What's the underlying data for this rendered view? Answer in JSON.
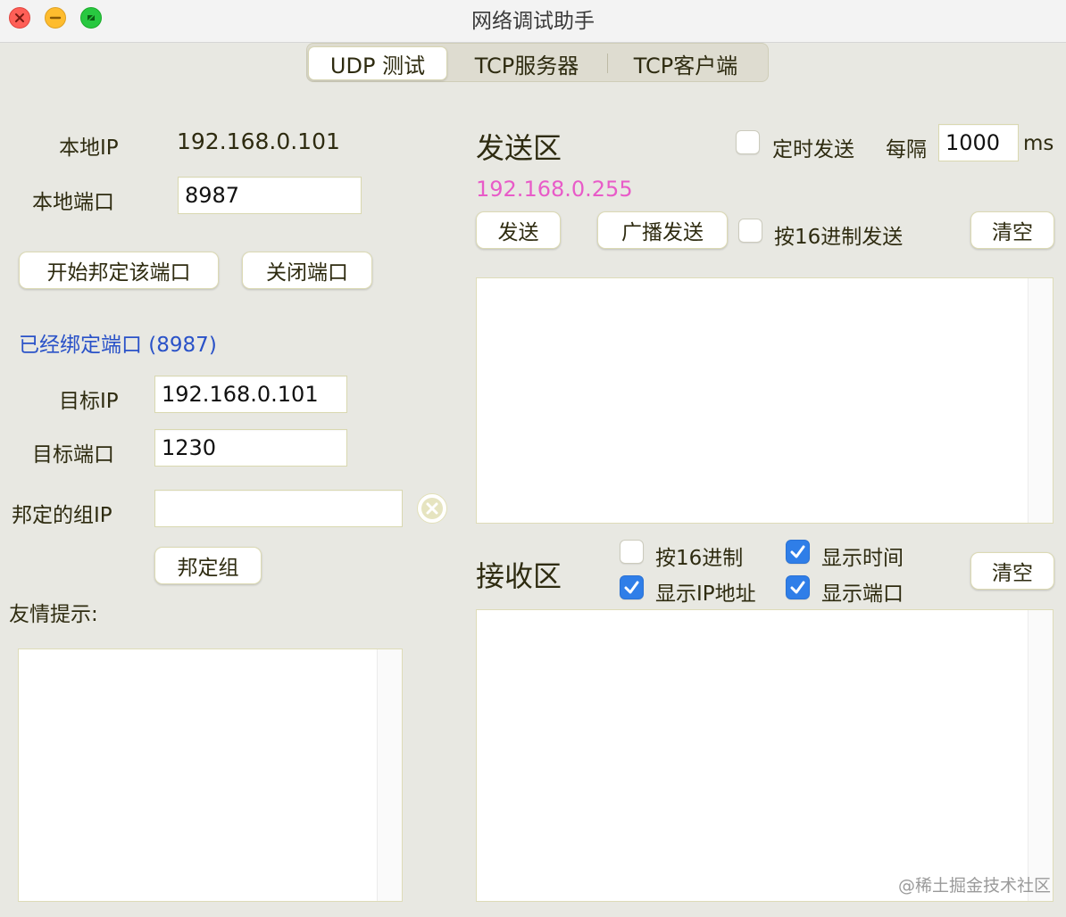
{
  "window": {
    "title": "网络调试助手"
  },
  "tabs": [
    {
      "label": "UDP 测试",
      "active": true
    },
    {
      "label": "TCP服务器",
      "active": false
    },
    {
      "label": "TCP客户端",
      "active": false
    }
  ],
  "left": {
    "local_ip_label": "本地IP",
    "local_ip_value": "192.168.0.101",
    "local_port_label": "本地端口",
    "local_port_value": "8987",
    "bind_button": "开始邦定该端口",
    "close_button": "关闭端口",
    "bound_status": "已经绑定端口 (8987)",
    "target_ip_label": "目标IP",
    "target_ip_value": "192.168.0.101",
    "target_port_label": "目标端口",
    "target_port_value": "1230",
    "group_ip_label": "邦定的组IP",
    "group_ip_value": "",
    "bind_group_button": "邦定组",
    "tip_label": "友情提示:"
  },
  "send": {
    "heading": "发送区",
    "timer_label": "定时发送",
    "interval_label": "每隔",
    "interval_value": "1000",
    "interval_unit": "ms",
    "broadcast_address": "192.168.0.255",
    "send_button": "发送",
    "broadcast_button": "广播发送",
    "hex_send_label": "按16进制发送",
    "clear_button": "清空"
  },
  "receive": {
    "heading": "接收区",
    "hex_label": "按16进制",
    "show_time_label": "显示时间",
    "show_ip_label": "显示IP地址",
    "show_port_label": "显示端口",
    "clear_button": "清空"
  },
  "watermark": "@稀土掘金技术社区",
  "colors": {
    "status_blue": "#2a52c8",
    "broadcast_pink": "#e85bc8",
    "checkbox_blue": "#2f7ee8"
  }
}
